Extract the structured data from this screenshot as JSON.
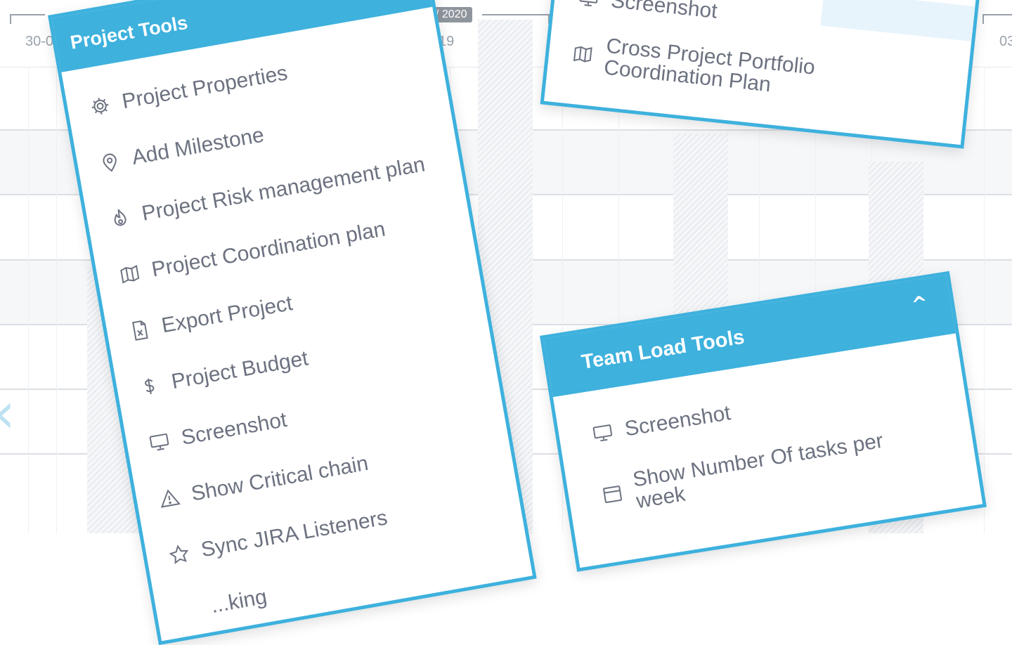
{
  "timeline": {
    "badge": "/ 2020",
    "dates": [
      "30-0",
      "19",
      "03"
    ]
  },
  "project_tools": {
    "title": "Project Tools",
    "items": [
      {
        "label": "Project Properties",
        "icon": "gear-icon"
      },
      {
        "label": "Add Milestone",
        "icon": "map-pin-icon"
      },
      {
        "label": "Project Risk management plan",
        "icon": "flame-icon"
      },
      {
        "label": "Project Coordination plan",
        "icon": "map-icon"
      },
      {
        "label": "Export Project",
        "icon": "excel-file-icon"
      },
      {
        "label": "Project Budget",
        "icon": "dollar-icon"
      },
      {
        "label": "Screenshot",
        "icon": "monitor-icon"
      },
      {
        "label": "Show Critical chain",
        "icon": "warning-icon"
      },
      {
        "label": "Sync JIRA Listeners",
        "icon": "star-icon"
      },
      {
        "label": "...king",
        "icon": "partial-icon"
      }
    ]
  },
  "cross_project": {
    "items": [
      {
        "label": "Screenshot",
        "icon": "monitor-icon"
      },
      {
        "label": "Cross Project Portfolio Coordination Plan",
        "icon": "map-icon"
      }
    ]
  },
  "team_load": {
    "title": "Team Load Tools",
    "collapse_icon": "chevron-up-icon",
    "items": [
      {
        "label": "Screenshot",
        "icon": "monitor-icon"
      },
      {
        "label": "Show Number Of tasks per week",
        "icon": "calendar-window-icon"
      }
    ]
  },
  "colors": {
    "accent": "#3eb1dd",
    "menu_text": "#6c7280",
    "axis": "#9aa1ab"
  }
}
